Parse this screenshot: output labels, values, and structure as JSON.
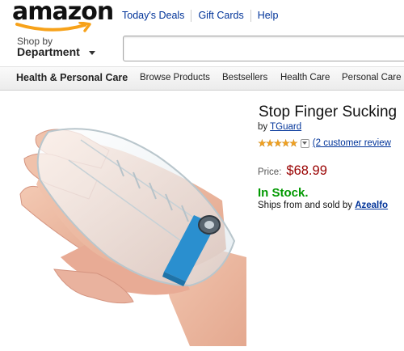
{
  "header": {
    "logo_text": "amazon",
    "nav": [
      "Today's Deals",
      "Gift Cards",
      "Help"
    ],
    "shop_by": "Shop by",
    "department": "Department",
    "search_value": ""
  },
  "subnav": {
    "items": [
      "Health & Personal Care",
      "Browse Products",
      "Bestsellers",
      "Health Care",
      "Personal Care"
    ]
  },
  "product": {
    "title": "Stop Finger Sucking",
    "by_prefix": "by",
    "brand": "TGuard",
    "stars": "★★★★★",
    "review_link": "(2 customer review",
    "review_prefix": "",
    "price_label": "Price:",
    "price": "$68.99",
    "stock": "In Stock.",
    "ships_text": "Ships from and sold by",
    "seller": "Azealfo"
  },
  "colors": {
    "link": "#003399",
    "price": "#990000",
    "stock": "#009900",
    "logo_smile": "#f7a21a",
    "strap": "#2a8fcf"
  }
}
